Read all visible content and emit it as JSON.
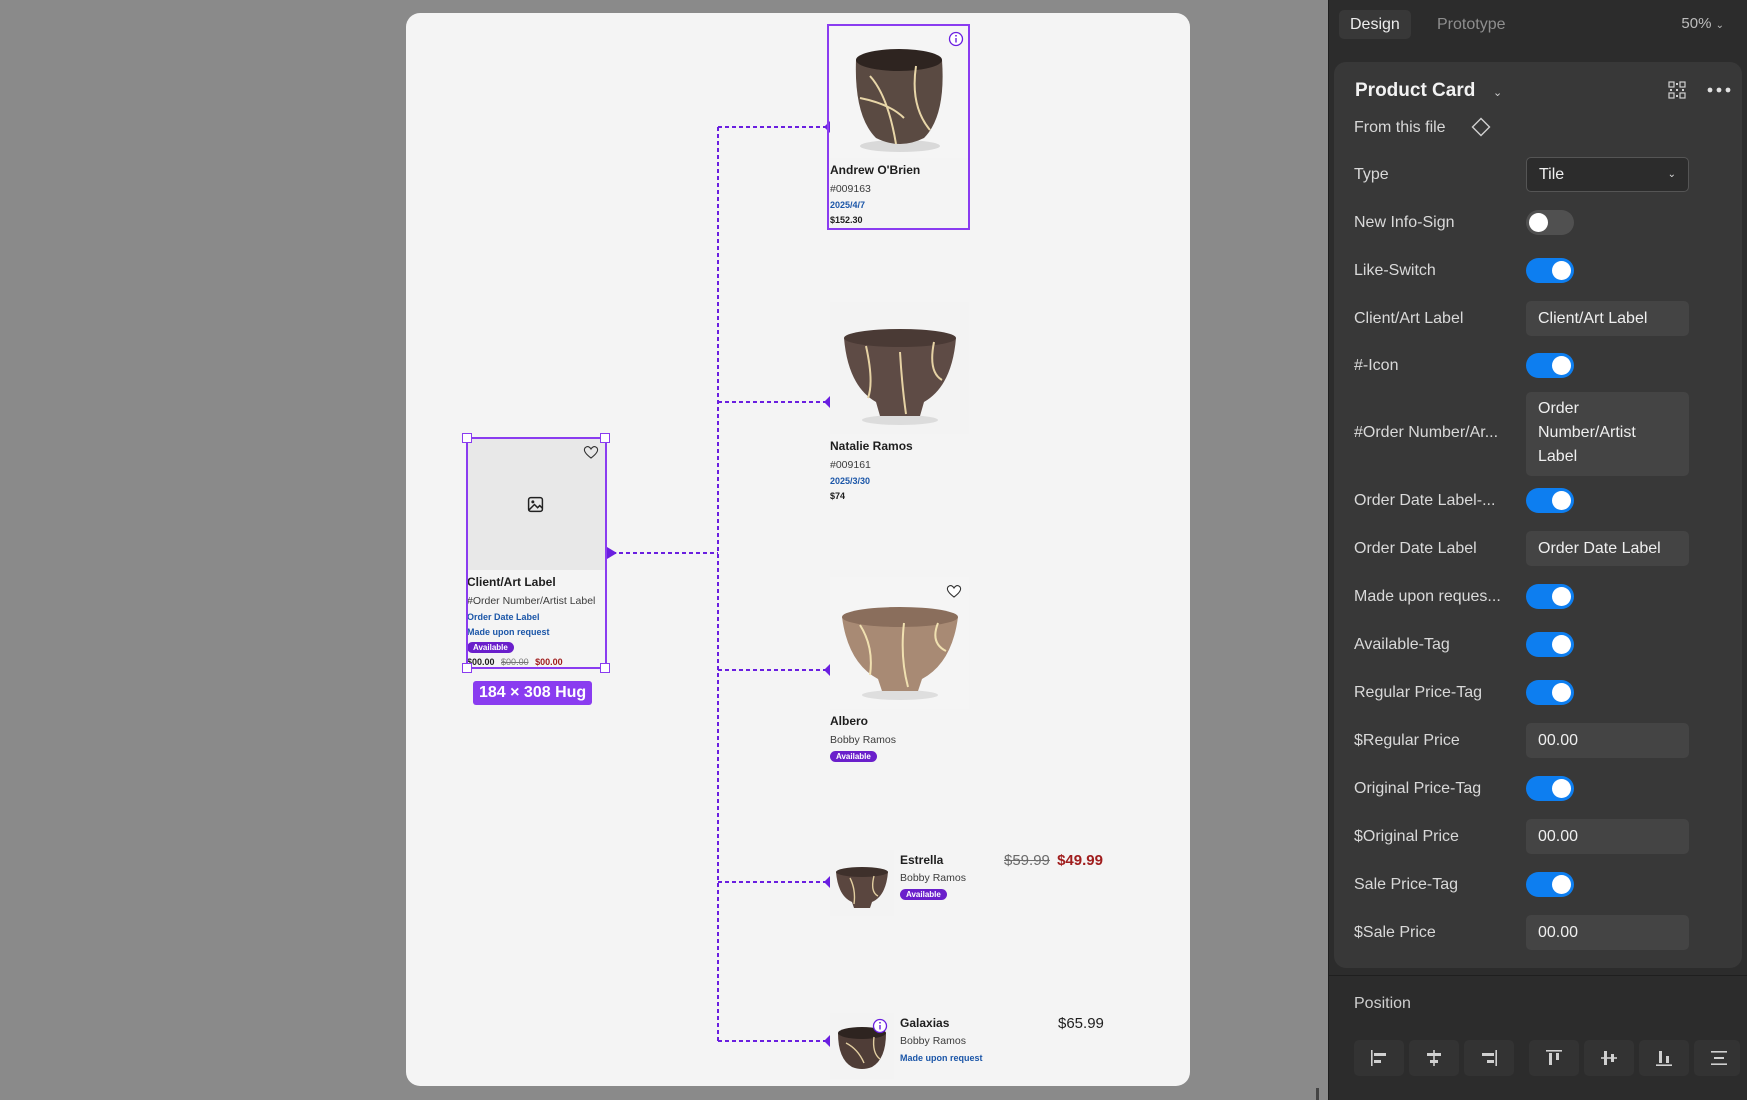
{
  "panel": {
    "tabs": [
      {
        "label": "Design",
        "active": true
      },
      {
        "label": "Prototype",
        "active": false
      }
    ],
    "zoom": "50%",
    "component_name": "Product Card",
    "source": "From this file",
    "properties": [
      {
        "label": "Type",
        "kind": "select",
        "value": "Tile"
      },
      {
        "label": "New Info-Sign",
        "kind": "toggle",
        "on": false
      },
      {
        "label": "Like-Switch",
        "kind": "toggle",
        "on": true
      },
      {
        "label": "Client/Art Label",
        "kind": "text",
        "value": "Client/Art Label"
      },
      {
        "label": "#-Icon",
        "kind": "toggle",
        "on": true
      },
      {
        "label": "#Order Number/Ar...",
        "kind": "text",
        "value": "Order Number/Artist Label"
      },
      {
        "label": "Order Date Label-...",
        "kind": "toggle",
        "on": true
      },
      {
        "label": "Order Date Label",
        "kind": "text",
        "value": "Order Date Label"
      },
      {
        "label": "Made upon reques...",
        "kind": "toggle",
        "on": true
      },
      {
        "label": "Available-Tag",
        "kind": "toggle",
        "on": true
      },
      {
        "label": "Regular Price-Tag",
        "kind": "toggle",
        "on": true
      },
      {
        "label": "$Regular Price",
        "kind": "text",
        "value": "00.00"
      },
      {
        "label": "Original Price-Tag",
        "kind": "toggle",
        "on": true
      },
      {
        "label": "$Original Price",
        "kind": "text",
        "value": "00.00"
      },
      {
        "label": "Sale Price-Tag",
        "kind": "toggle",
        "on": true
      },
      {
        "label": "$Sale Price",
        "kind": "text",
        "value": "00.00"
      }
    ],
    "position_label": "Position",
    "align_icons": [
      "align-left-icon",
      "align-center-h-icon",
      "align-right-icon",
      "align-top-icon",
      "align-center-v-icon",
      "align-bottom-icon",
      "distribute-icon"
    ]
  },
  "canvas": {
    "size_badge": "184 × 308 Hug",
    "master": {
      "name": "Client/Art Label",
      "order": "#Order Number/Artist Label",
      "date": "Order Date Label",
      "made": "Made upon request",
      "tag": "Available",
      "regular": "$00.00",
      "original": "$00.00",
      "sale": "$00.00"
    },
    "variants": [
      {
        "name": "Andrew O'Brien",
        "order": "#009163",
        "date": "2025/4/7",
        "price": "$152.30"
      },
      {
        "name": "Natalie Ramos",
        "order": "#009161",
        "date": "2025/3/30",
        "price": "$74"
      },
      {
        "name": "Albero",
        "artist": "Bobby Ramos",
        "tag": "Available"
      },
      {
        "name": "Estrella",
        "artist": "Bobby Ramos",
        "tag": "Available",
        "original": "$59.99",
        "sale": "$49.99"
      },
      {
        "name": "Galaxias",
        "artist": "Bobby Ramos",
        "made": "Made upon request",
        "price": "$65.99"
      }
    ]
  },
  "colors": {
    "accent": "#8a3cf0",
    "toggle_on": "#0d7ef0",
    "tag": "#6a1fcb",
    "date_blue": "#1b56a8",
    "sale_red": "#a01d1d"
  }
}
